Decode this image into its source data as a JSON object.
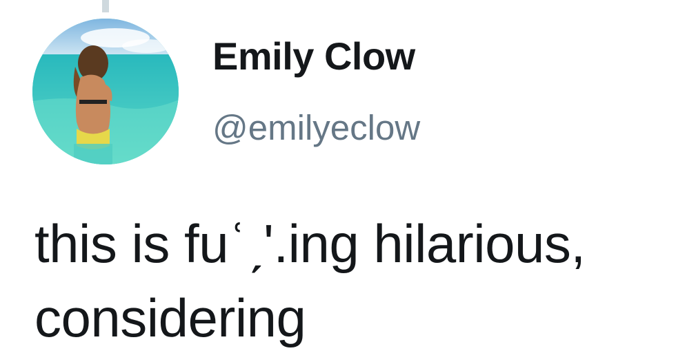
{
  "tweet": {
    "author": {
      "display_name": "Emily Clow",
      "handle": "@emilyeclow",
      "avatar_icon": "profile-photo-beach"
    },
    "text_line1": "this is fuʿˏʹ.ing hilarious,",
    "text_line2": "considering"
  },
  "colors": {
    "name": "#14171a",
    "handle": "#657786",
    "text": "#14171a",
    "thread_line": "#cfd9de"
  }
}
